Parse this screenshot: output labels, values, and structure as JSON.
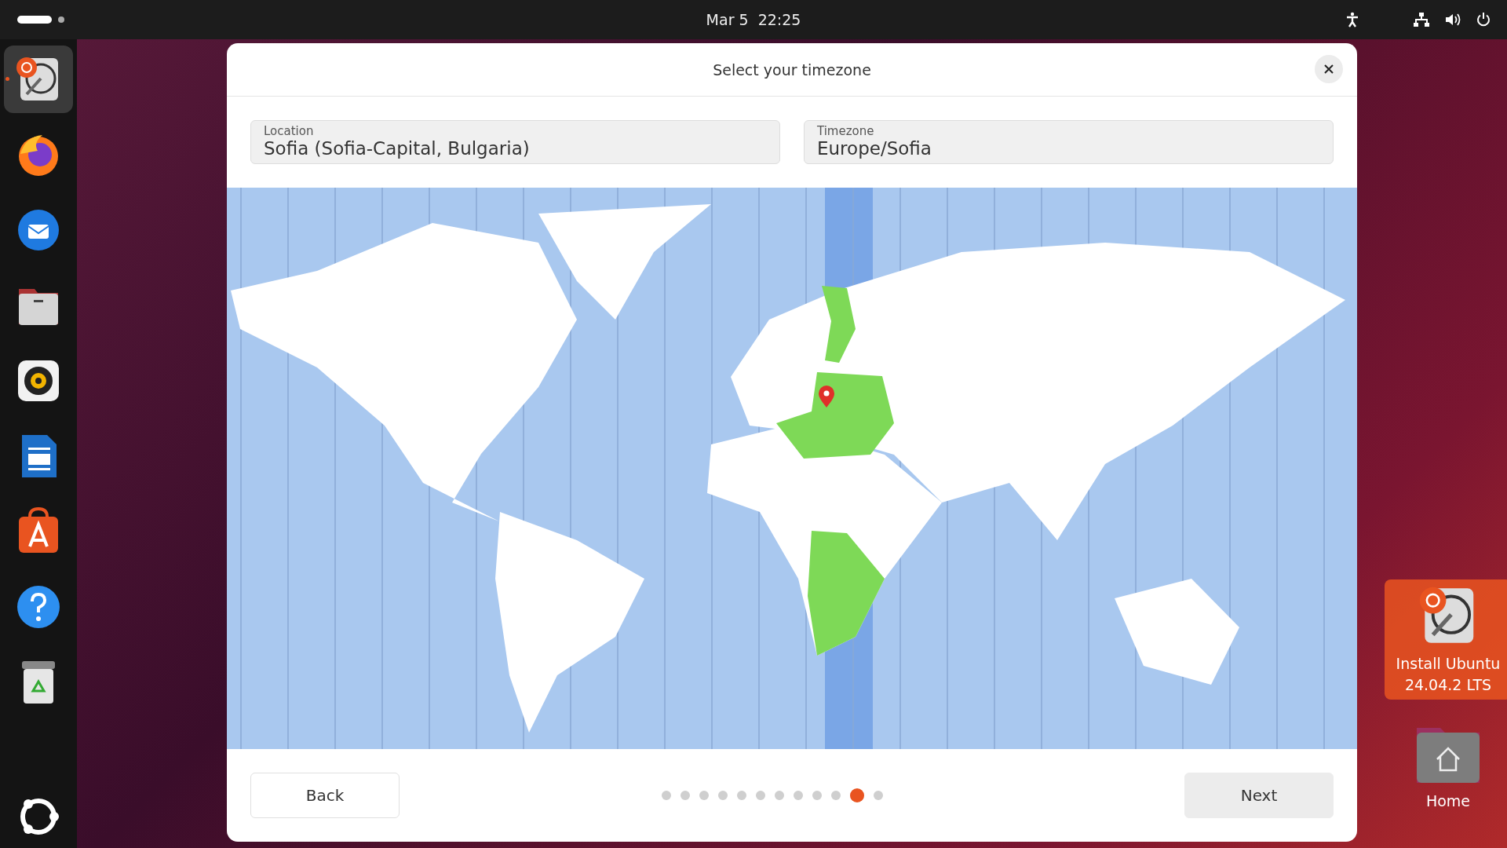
{
  "top_bar": {
    "clock": "Mar 5  22:25"
  },
  "dock": [
    {
      "kind": "installer",
      "selected": true
    },
    {
      "kind": "firefox",
      "selected": false
    },
    {
      "kind": "thunderbird",
      "selected": false
    },
    {
      "kind": "files",
      "selected": false
    },
    {
      "kind": "rhythmbox",
      "selected": false
    },
    {
      "kind": "writer",
      "selected": false
    },
    {
      "kind": "appcenter",
      "selected": false
    },
    {
      "kind": "help",
      "selected": false
    },
    {
      "kind": "trash",
      "selected": false
    }
  ],
  "dialog": {
    "title": "Select your timezone",
    "location": {
      "label": "Location",
      "value": "Sofia (Sofia-Capital, Bulgaria)"
    },
    "timezone": {
      "label": "Timezone",
      "value": "Europe/Sofia"
    },
    "back_button": "Back",
    "pages": [
      {
        "selected": false
      },
      {
        "selected": false
      },
      {
        "selected": false
      },
      {
        "selected": false
      },
      {
        "selected": false
      },
      {
        "selected": false
      },
      {
        "selected": false
      },
      {
        "selected": false
      },
      {
        "selected": false
      },
      {
        "selected": false
      },
      {
        "selected": true
      },
      {
        "selected": false
      }
    ],
    "next_button": "Next"
  },
  "desktop_icons": [
    {
      "kind": "installer",
      "label": "Install Ubuntu 24.04.2 LTS",
      "selected": true
    },
    {
      "kind": "home",
      "label": "Home",
      "selected": false
    }
  ]
}
